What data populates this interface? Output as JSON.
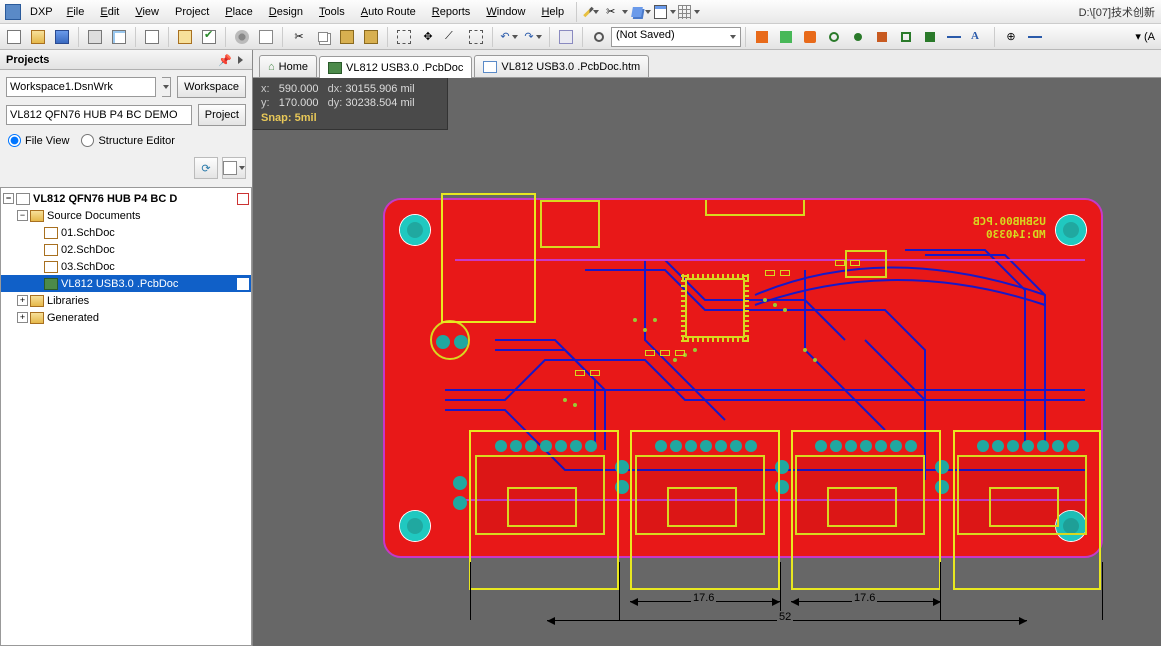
{
  "app": {
    "name": "DXP",
    "filepath": "D:\\[07]技术创新"
  },
  "menu": {
    "file": "File",
    "edit": "Edit",
    "view": "View",
    "project": "Project",
    "place": "Place",
    "design": "Design",
    "tools": "Tools",
    "autoroute": "Auto Route",
    "reports": "Reports",
    "window": "Window",
    "help": "Help"
  },
  "toolbar": {
    "combo_saved": "(Not Saved)",
    "right_text": "▾ (A"
  },
  "panel": {
    "title": "Projects",
    "workspace_value": "Workspace1.DsnWrk",
    "workspace_btn": "Workspace",
    "project_value": "VL812 QFN76 HUB P4 BC DEMO",
    "project_btn": "Project",
    "radio_file": "File View",
    "radio_struct": "Structure Editor"
  },
  "tree": {
    "root": "VL812 QFN76 HUB P4 BC D",
    "src_docs": "Source Documents",
    "doc1": "01.SchDoc",
    "doc2": "02.SchDoc",
    "doc3": "03.SchDoc",
    "pcb": "VL812 USB3.0 .PcbDoc",
    "libraries": "Libraries",
    "generated": "Generated"
  },
  "tabs": {
    "home": "Home",
    "pcb": "VL812 USB3.0 .PcbDoc",
    "htm": "VL812 USB3.0 .PcbDoc.htm"
  },
  "coords": {
    "x_label": "x:",
    "x_val": "590.000",
    "dx_label": "dx:",
    "dx_val": "30155.906 mil",
    "y_label": "y:",
    "y_val": "170.000",
    "dy_label": "dy:",
    "dy_val": "30238.504 mil",
    "snap": "Snap: 5mil"
  },
  "pcb": {
    "silk1": "USBHB00.PCB",
    "silk2": "MD:140330",
    "dim_176a": "17.6",
    "dim_176b": "17.6",
    "dim_52": "52"
  }
}
